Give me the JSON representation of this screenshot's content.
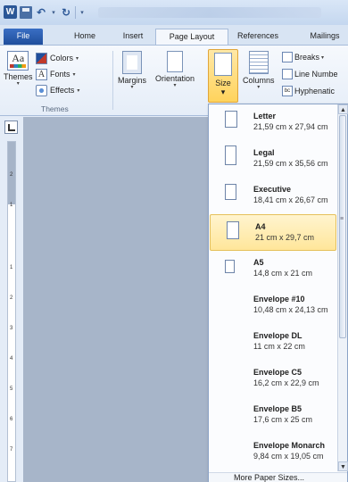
{
  "ribbon_tabs": {
    "file": "File",
    "home": "Home",
    "insert": "Insert",
    "page_layout": "Page Layout",
    "references": "References",
    "mailings": "Mailings"
  },
  "themes_group": {
    "themes_label": "Themes",
    "colors_label": "Colors",
    "fonts_label": "Fonts",
    "effects_label": "Effects",
    "group_label": "Themes"
  },
  "page_setup": {
    "margins_label": "Margins",
    "orientation_label": "Orientation",
    "size_label": "Size",
    "columns_label": "Columns",
    "breaks_label": "Breaks",
    "line_numbers_label": "Line Numbe",
    "hyphenation_label": "Hyphenatic"
  },
  "icons": {
    "word": "W",
    "undo": "↶",
    "redo": "↻",
    "caret": "▾",
    "scroll_up": "▲",
    "scroll_down": "▼"
  },
  "ruler_ticks": [
    "2",
    "1",
    "1",
    "2",
    "3",
    "4",
    "5",
    "6",
    "7"
  ],
  "paper_sizes": [
    {
      "name": "Letter",
      "dims": "21,59 cm x 27,94 cm",
      "selected": false
    },
    {
      "name": "Legal",
      "dims": "21,59 cm x 35,56 cm",
      "selected": false
    },
    {
      "name": "Executive",
      "dims": "18,41 cm x 26,67 cm",
      "selected": false
    },
    {
      "name": "A4",
      "dims": "21 cm x 29,7 cm",
      "selected": true
    },
    {
      "name": "A5",
      "dims": "14,8 cm x 21 cm",
      "selected": false
    },
    {
      "name": "Envelope #10",
      "dims": "10,48 cm x 24,13 cm",
      "selected": false
    },
    {
      "name": "Envelope DL",
      "dims": "11 cm x 22 cm",
      "selected": false
    },
    {
      "name": "Envelope C5",
      "dims": "16,2 cm x 22,9 cm",
      "selected": false
    },
    {
      "name": "Envelope B5",
      "dims": "17,6 cm x 25 cm",
      "selected": false
    },
    {
      "name": "Envelope Monarch",
      "dims": "9,84 cm x 19,05 cm",
      "selected": false
    }
  ],
  "more_paper_sizes": "More Paper Sizes...",
  "colors": {
    "accent": "#2b5797",
    "highlight": "#ffe69a",
    "highlight_border": "#e5c05a"
  }
}
